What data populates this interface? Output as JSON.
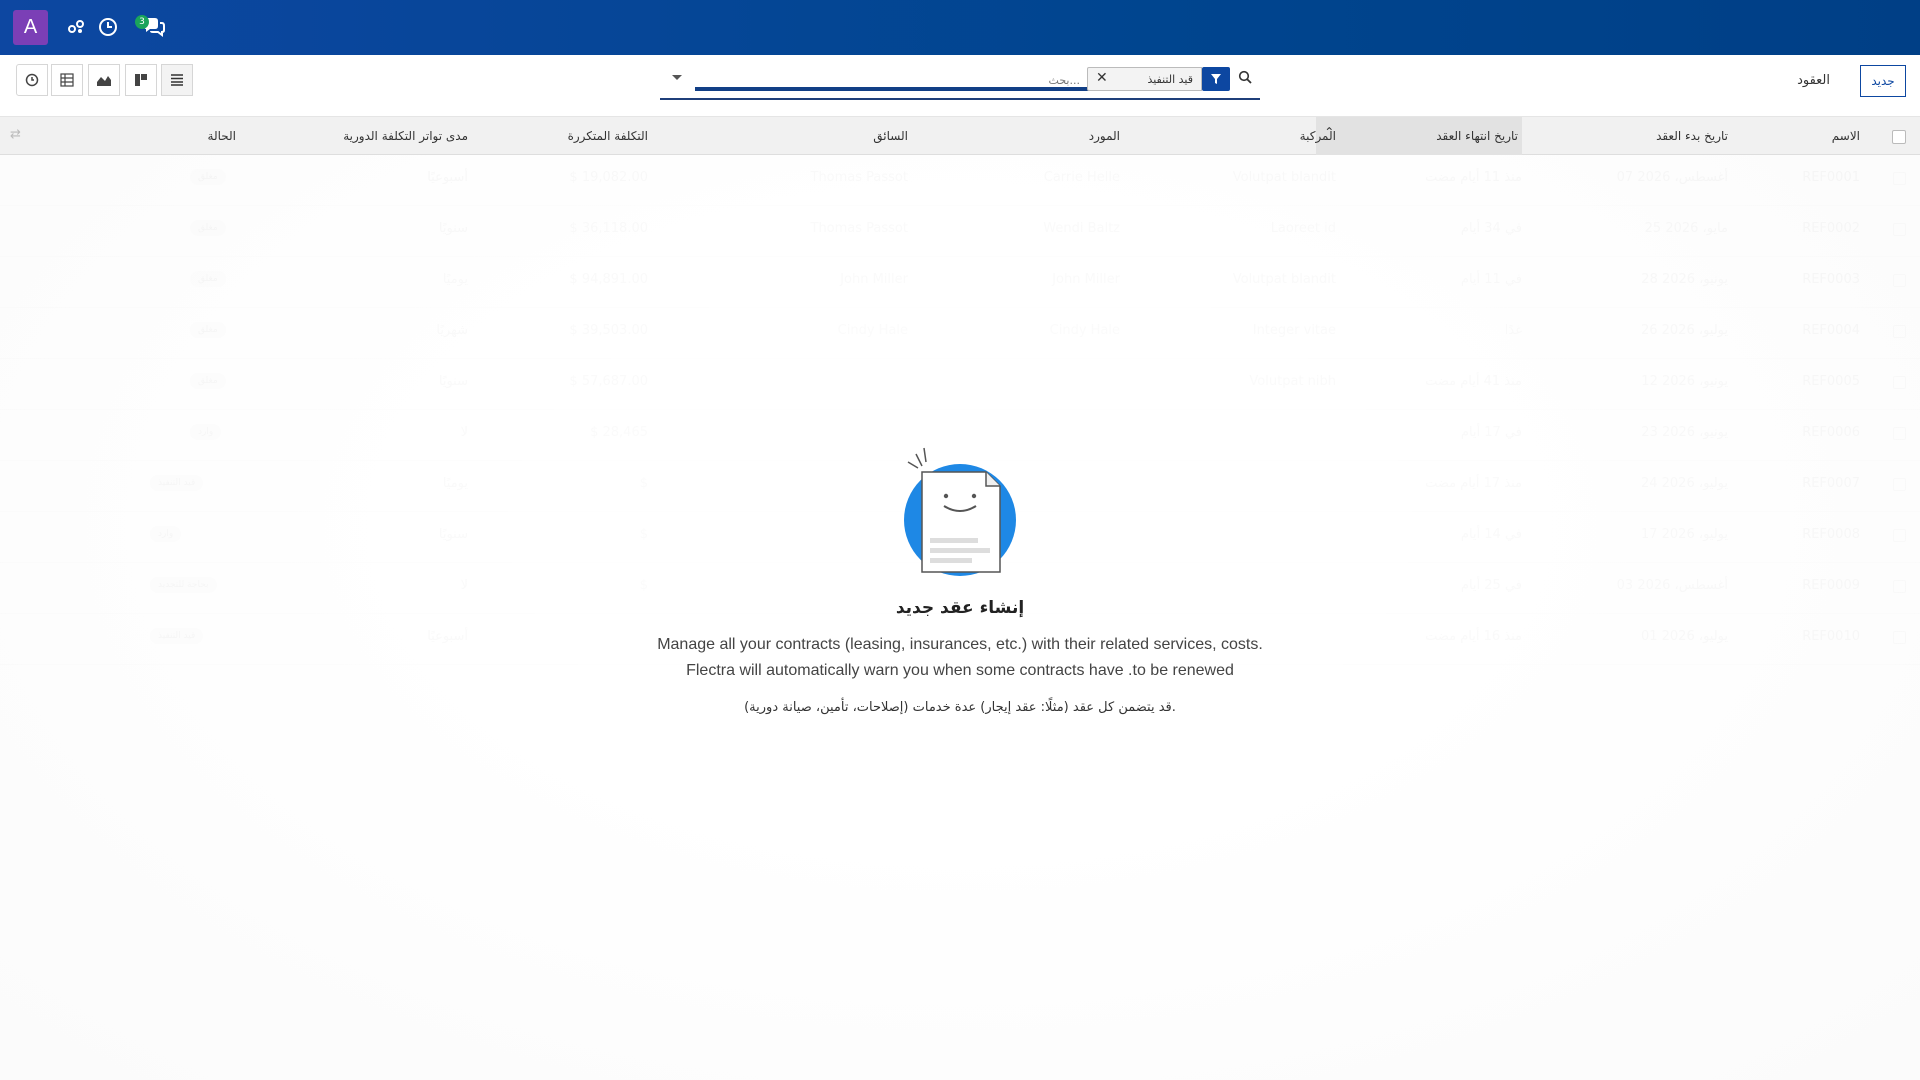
{
  "topbar": {
    "avatar_letter": "A",
    "messages_count": "3",
    "icons": [
      "activity-icon",
      "clock-icon",
      "chat-icon"
    ]
  },
  "control_panel": {
    "breadcrumb": "العقود",
    "new_button": "جديد",
    "search_placeholder": "بحث...",
    "facet_label": "قيد التنفيذ",
    "views": [
      "activity-view",
      "pivot-view",
      "graph-view",
      "kanban-view",
      "list-view"
    ]
  },
  "table": {
    "columns": [
      "الاسم",
      "تاريخ بدء العقد",
      "تاريخ انتهاء العقد",
      "المركبة",
      "المورد",
      "السائق",
      "التكلفة المتكررة",
      "مدى تواتر التكلفة الدورية",
      "الحالة"
    ],
    "rows": [
      {
        "name": "REF0001",
        "start": "07 أغسطس، 2026",
        "expiry": "منذ 11 أيام مضت",
        "vehicle": "Volutpat blandit",
        "vendor": "Carrie Helle",
        "driver": "Thomas Passot",
        "cost": "$ 19,082.00",
        "freq": "أسبوعيًا",
        "status": "مغلق"
      },
      {
        "name": "REF0002",
        "start": "25 مايو، 2026",
        "expiry": "في 34 أيام",
        "vehicle": "Laoreet id",
        "vendor": "Wendi Baltz",
        "driver": "Thomas Passot",
        "cost": "$ 36,118.00",
        "freq": "سنويًا",
        "status": "مغلق"
      },
      {
        "name": "REF0003",
        "start": "28 يونيو، 2026",
        "expiry": "في 11 أيام",
        "vehicle": "Volutpat blandit",
        "vendor": "John Miller",
        "driver": "John Miller",
        "cost": "$ 94,891.00",
        "freq": "يوميًا",
        "status": "مغلق"
      },
      {
        "name": "REF0004",
        "start": "26 يوليو، 2026",
        "expiry": "غدًا",
        "vehicle": "Integer vitae",
        "vendor": "Cindy Hale",
        "driver": "Cindy Hale",
        "cost": "$ 39,503.00",
        "freq": "شهريًا",
        "status": "مغلق"
      },
      {
        "name": "REF0005",
        "start": "12 يونيو، 2026",
        "expiry": "منذ 41 أيام مضت",
        "vehicle": "Volutpat nibh",
        "vendor": "",
        "driver": "",
        "cost": "$ 57,687.00",
        "freq": "سنويًا",
        "status": "مغلق"
      },
      {
        "name": "REF0006",
        "start": "23 يونيو، 2026",
        "expiry": "في 17 أيام",
        "vehicle": "",
        "vendor": "",
        "driver": "",
        "cost": "$ 28,465",
        "freq": "لا",
        "status": "وارد"
      },
      {
        "name": "REF0007",
        "start": "24 يوليو، 2026",
        "expiry": "منذ 17 أيام مضت",
        "vehicle": "",
        "vendor": "",
        "driver": "",
        "cost": "$ ",
        "freq": "يوميًا",
        "status": "قيد التنفيذ"
      },
      {
        "name": "REF0008",
        "start": "17 يوليو، 2026",
        "expiry": "في 14 أيام",
        "vehicle": "",
        "vendor": "",
        "driver": "",
        "cost": "$ ",
        "freq": "سنويًا",
        "status": "وارد"
      },
      {
        "name": "REF0009",
        "start": "03 أغسطس، 2026",
        "expiry": "في 25 أيام",
        "vehicle": "",
        "vendor": "",
        "driver": "",
        "cost": "$ ",
        "freq": "لا",
        "status": "بحاجة للتجديد"
      },
      {
        "name": "REF0010",
        "start": "01 يوليو، 2026",
        "expiry": "منذ 16 أيام مضت",
        "vehicle": "",
        "vendor": "",
        "driver": "",
        "cost": "",
        "freq": "أسبوعيًا",
        "status": "قيد التنفيذ"
      }
    ]
  },
  "helper": {
    "title": "إنشاء عقد جديد",
    "text": "Manage all your contracts (leasing, insurances, etc.) with their related services, costs. Flectra will automatically warn you when some contracts have .to be renewed",
    "note": "قد يتضمن كل عقد (مثلًا: عقد إيجار) عدة خدمات (إصلاحات، تأمين، صيانة دورية)."
  },
  "colors": {
    "topbar": "#0d47a1",
    "avatar": "#7b3fb6",
    "accent": "#0d47a1",
    "badge": "#1aa45b"
  }
}
